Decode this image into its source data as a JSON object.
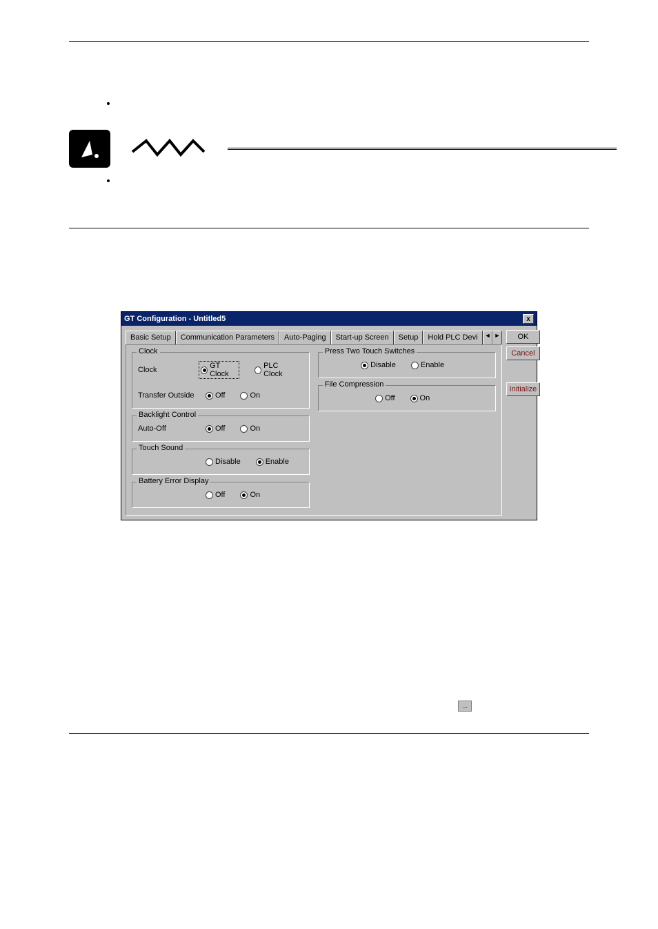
{
  "page": {
    "top_rule": true,
    "bottom_rule": true
  },
  "dialog": {
    "title": "GT Configuration - Untitled5",
    "close_icon": "x",
    "tabs": {
      "items": [
        {
          "label": "Basic Setup",
          "active": false
        },
        {
          "label": "Communication Parameters",
          "active": false
        },
        {
          "label": "Auto-Paging",
          "active": false
        },
        {
          "label": "Start-up Screen",
          "active": false
        },
        {
          "label": "Setup",
          "active": true
        },
        {
          "label": "Hold PLC Devi",
          "active": false
        }
      ],
      "nav_left": "◄",
      "nav_right": "►"
    },
    "buttons": {
      "ok": "OK",
      "cancel": "Cancel",
      "initialize": "Initialize"
    },
    "groups": {
      "clock": {
        "title": "Clock",
        "clock_label": "Clock",
        "clock_options": [
          {
            "label": "GT Clock",
            "selected": true,
            "boxed": true
          },
          {
            "label": "PLC Clock",
            "selected": false
          }
        ],
        "transfer_label": "Transfer Outside",
        "transfer_options": [
          {
            "label": "Off",
            "selected": true
          },
          {
            "label": "On",
            "selected": false
          }
        ]
      },
      "backlight": {
        "title": "Backlight Control",
        "autooff_label": "Auto-Off",
        "autooff_options": [
          {
            "label": "Off",
            "selected": true
          },
          {
            "label": "On",
            "selected": false
          }
        ]
      },
      "touchsound": {
        "title": "Touch Sound",
        "options": [
          {
            "label": "Disable",
            "selected": false
          },
          {
            "label": "Enable",
            "selected": true
          }
        ]
      },
      "battery": {
        "title": "Battery Error Display",
        "options": [
          {
            "label": "Off",
            "selected": false
          },
          {
            "label": "On",
            "selected": true
          }
        ]
      },
      "presstwo": {
        "title": "Press Two Touch Switches",
        "options": [
          {
            "label": "Disable",
            "selected": true
          },
          {
            "label": "Enable",
            "selected": false
          }
        ]
      },
      "filecomp": {
        "title": "File Compression",
        "options": [
          {
            "label": "Off",
            "selected": false
          },
          {
            "label": "On",
            "selected": true
          }
        ]
      }
    }
  },
  "icons": {
    "tip_icon": "tip",
    "ellipsis_button": "..."
  }
}
